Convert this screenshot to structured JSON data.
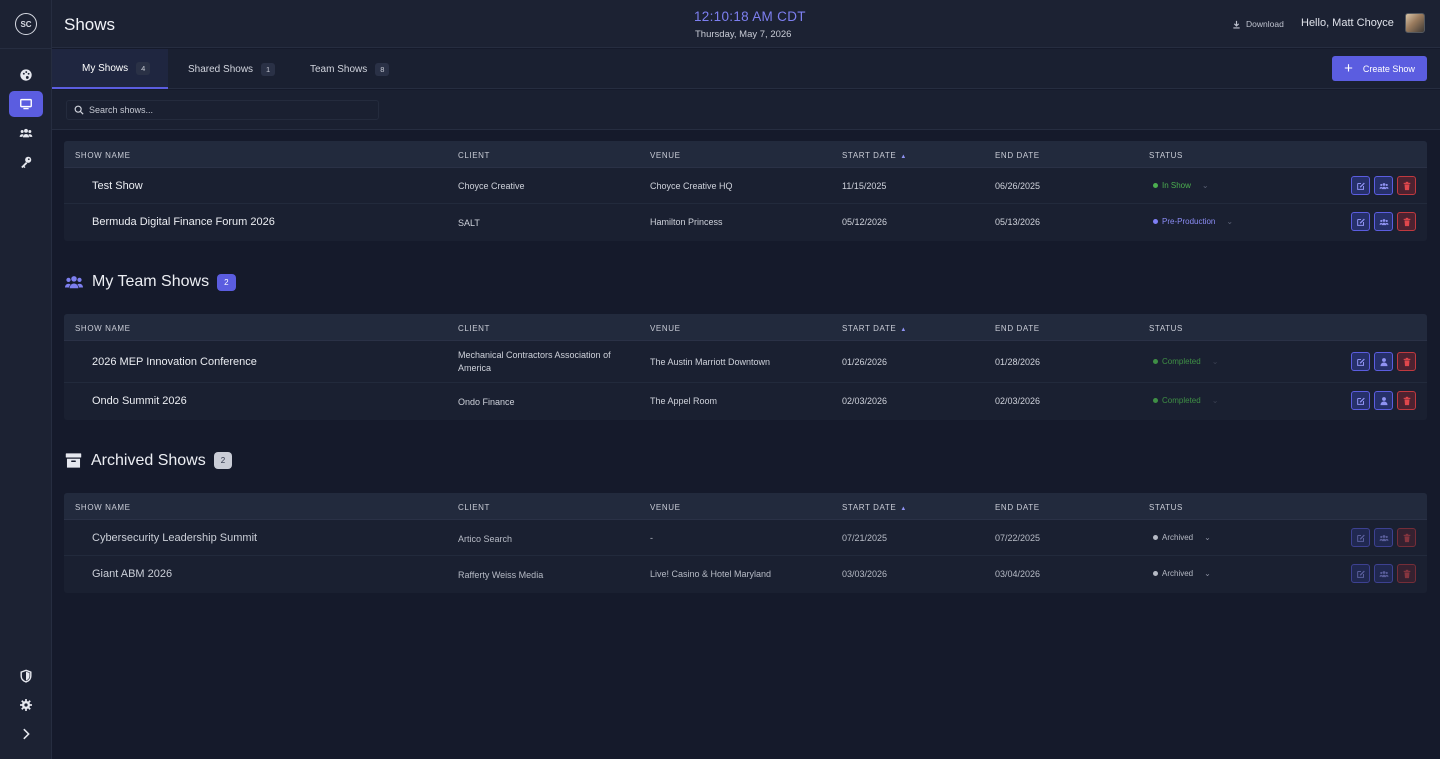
{
  "header": {
    "title": "Shows",
    "clock": "12:10:18 AM CDT",
    "date": "Thursday, May 7, 2026",
    "download_label": "Download",
    "greeting": "Hello, Matt Choyce"
  },
  "sidebar": {
    "logo_text": "SC",
    "items": [
      {
        "icon": "palette-icon",
        "active": false
      },
      {
        "icon": "monitor-icon",
        "active": true
      },
      {
        "icon": "users-icon",
        "active": false
      },
      {
        "icon": "key-icon",
        "active": false
      }
    ],
    "bottom_items": [
      "shield-icon",
      "gear-icon",
      "chevron-right-icon"
    ]
  },
  "tabs": [
    {
      "label": "My Shows",
      "count": "4",
      "active": true
    },
    {
      "label": "Shared Shows",
      "count": "1",
      "active": false
    },
    {
      "label": "Team Shows",
      "count": "8",
      "active": false
    }
  ],
  "create_button": "Create Show",
  "search": {
    "placeholder": "Search shows..."
  },
  "columns": [
    "SHOW NAME",
    "CLIENT",
    "VENUE",
    "START DATE",
    "END DATE",
    "STATUS"
  ],
  "my_shows": {
    "rows": [
      {
        "name": "Test Show",
        "client": "Choyce Creative",
        "venue": "Choyce Creative HQ",
        "start": "11/15/2025",
        "end": "06/26/2025",
        "status": "In Show"
      },
      {
        "name": "Bermuda Digital Finance Forum 2026",
        "client": "SALT",
        "venue": "Hamilton Princess",
        "start": "05/12/2026",
        "end": "05/13/2026",
        "status": "Pre-Production"
      }
    ]
  },
  "team_shows": {
    "title": "My Team Shows",
    "count": "2",
    "rows": [
      {
        "name": "2026 MEP Innovation Conference",
        "client": "Mechanical Contractors Association of America",
        "venue": "The Austin Marriott Downtown",
        "start": "01/26/2026",
        "end": "01/28/2026",
        "status": "Completed"
      },
      {
        "name": "Ondo Summit 2026",
        "client": "Ondo Finance",
        "venue": "The Appel Room",
        "start": "02/03/2026",
        "end": "02/03/2026",
        "status": "Completed"
      }
    ]
  },
  "archived_shows": {
    "title": "Archived Shows",
    "count": "2",
    "rows": [
      {
        "name": "Cybersecurity Leadership Summit",
        "client": "Artico Search",
        "venue": "-",
        "start": "07/21/2025",
        "end": "07/22/2025",
        "status": "Archived"
      },
      {
        "name": "Giant ABM 2026",
        "client": "Rafferty Weiss Media",
        "venue": "Live! Casino & Hotel Maryland",
        "start": "03/03/2026",
        "end": "03/04/2026",
        "status": "Archived"
      }
    ]
  },
  "colors": {
    "accent": "#5b5de0",
    "in_show": "#4caf50",
    "pre_production": "#7f7ff5",
    "completed": "#3f8f45",
    "archived": "#b5b9c4",
    "delete": "#e0474c"
  }
}
